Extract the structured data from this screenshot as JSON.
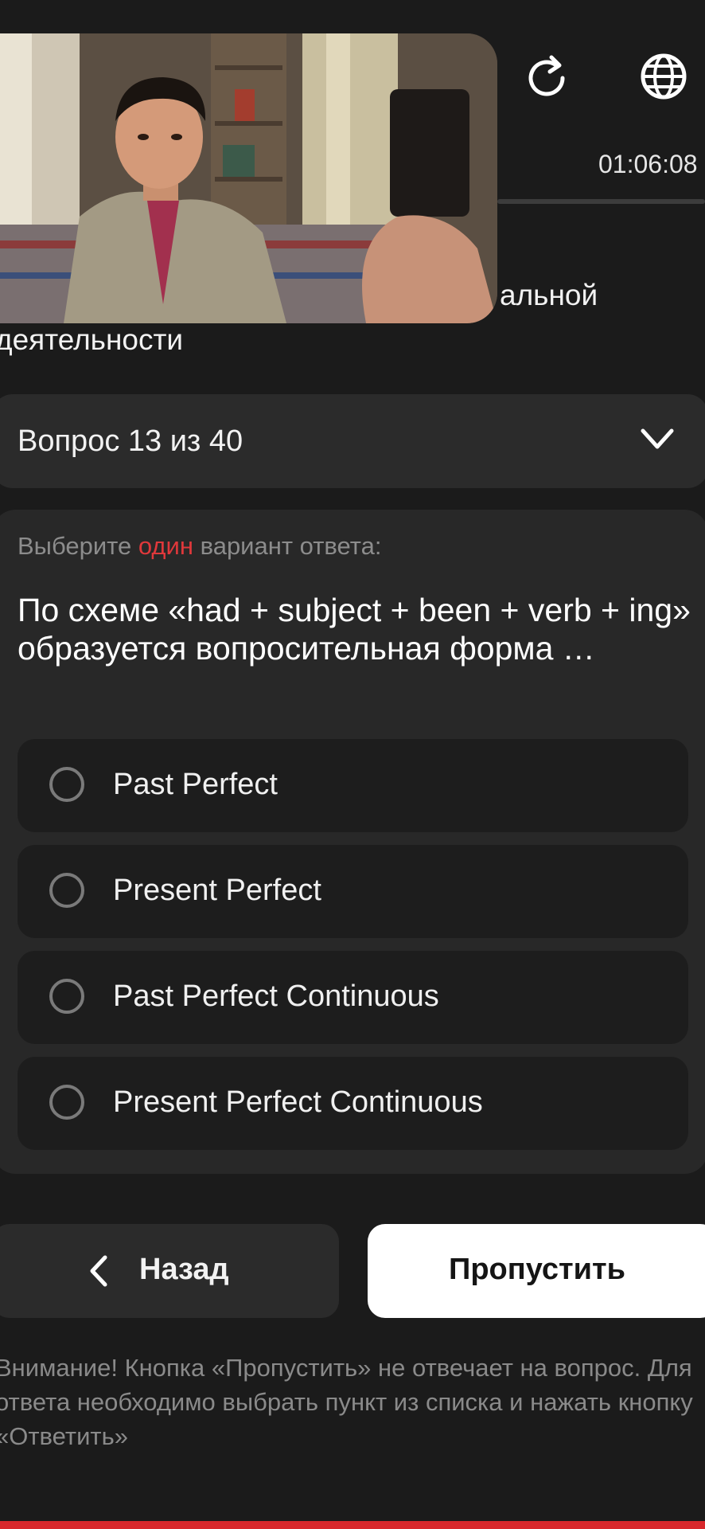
{
  "header": {
    "timer": "01:06:08",
    "icons": [
      "refresh-icon",
      "globe-icon"
    ]
  },
  "course": {
    "line1": "альной",
    "line2": "деятельности"
  },
  "question_selector": {
    "label": "Вопрос 13 из 40"
  },
  "question": {
    "hint_before": "Выберите ",
    "hint_accent": "один",
    "hint_after": " вариант ответа:",
    "text": "По схеме «had + subject + been + verb + ing» образуется вопросительная форма …",
    "options": [
      {
        "label": "Past Perfect"
      },
      {
        "label": "Present Perfect"
      },
      {
        "label": "Past Perfect Continuous"
      },
      {
        "label": "Present Perfect Continuous"
      }
    ]
  },
  "buttons": {
    "back": "Назад",
    "skip": "Пропустить"
  },
  "warning": "Внимание! Кнопка «Пропустить» не отвечает на вопрос. Для ответа необходимо выбрать пункт из списка и нажать кнопку «Ответить»",
  "colors": {
    "background": "#1b1b1b",
    "accent": "#e0383b",
    "skip_button": "#ffffff"
  }
}
